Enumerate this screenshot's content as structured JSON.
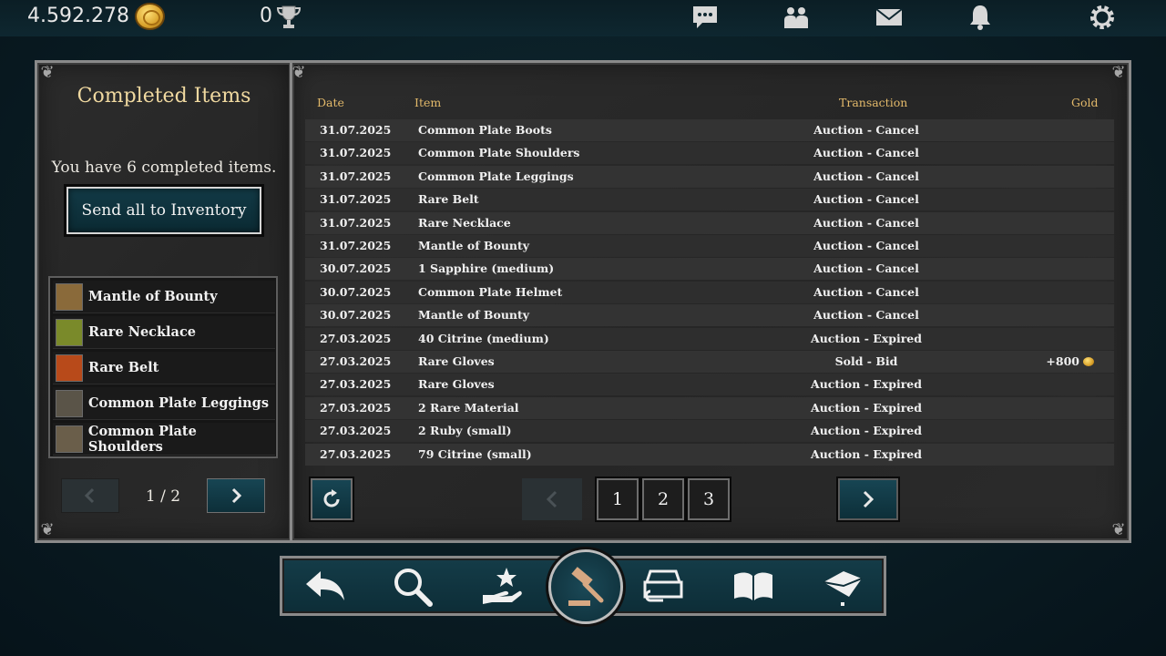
{
  "topbar": {
    "gold": "4.592.278",
    "trophies": "0",
    "icons": [
      "chat-icon",
      "friends-icon",
      "mail-icon",
      "bell-icon",
      "gear-icon"
    ]
  },
  "left": {
    "title": "Completed Items",
    "count_text": "You have 6 completed items.",
    "send_all_label": "Send all to Inventory",
    "items": [
      {
        "label": "Mantle of Bounty",
        "color": "#8a6a3a"
      },
      {
        "label": "Rare Necklace",
        "color": "#7a8a2a"
      },
      {
        "label": "Rare Belt",
        "color": "#b84a1a"
      },
      {
        "label": "Common Plate Leggings",
        "color": "#5a5448"
      },
      {
        "label": "Common Plate Shoulders",
        "color": "#6a5e4a"
      }
    ],
    "page_indicator": "1 / 2"
  },
  "table": {
    "headers": {
      "date": "Date",
      "item": "Item",
      "transaction": "Transaction",
      "gold": "Gold"
    },
    "rows": [
      {
        "date": "31.07.2025",
        "item": "Common Plate Boots",
        "transaction": "Auction - Cancel",
        "gold": ""
      },
      {
        "date": "31.07.2025",
        "item": "Common Plate Shoulders",
        "transaction": "Auction - Cancel",
        "gold": ""
      },
      {
        "date": "31.07.2025",
        "item": "Common Plate Leggings",
        "transaction": "Auction - Cancel",
        "gold": ""
      },
      {
        "date": "31.07.2025",
        "item": "Rare Belt",
        "transaction": "Auction - Cancel",
        "gold": ""
      },
      {
        "date": "31.07.2025",
        "item": "Rare Necklace",
        "transaction": "Auction - Cancel",
        "gold": ""
      },
      {
        "date": "31.07.2025",
        "item": "Mantle of Bounty",
        "transaction": "Auction - Cancel",
        "gold": ""
      },
      {
        "date": "30.07.2025",
        "item": "1 Sapphire (medium)",
        "transaction": "Auction - Cancel",
        "gold": ""
      },
      {
        "date": "30.07.2025",
        "item": "Common Plate Helmet",
        "transaction": "Auction - Cancel",
        "gold": ""
      },
      {
        "date": "30.07.2025",
        "item": "Mantle of Bounty",
        "transaction": "Auction - Cancel",
        "gold": ""
      },
      {
        "date": "27.03.2025",
        "item": "40 Citrine (medium)",
        "transaction": "Auction - Expired",
        "gold": ""
      },
      {
        "date": "27.03.2025",
        "item": "Rare Gloves",
        "transaction": "Sold - Bid",
        "gold": "+800"
      },
      {
        "date": "27.03.2025",
        "item": "Rare Gloves",
        "transaction": "Auction - Expired",
        "gold": ""
      },
      {
        "date": "27.03.2025",
        "item": "2 Rare Material",
        "transaction": "Auction - Expired",
        "gold": ""
      },
      {
        "date": "27.03.2025",
        "item": "2 Ruby (small)",
        "transaction": "Auction - Expired",
        "gold": ""
      },
      {
        "date": "27.03.2025",
        "item": "79 Citrine (small)",
        "transaction": "Auction - Expired",
        "gold": ""
      }
    ],
    "pages": [
      "1",
      "2",
      "3"
    ]
  },
  "bottom_nav": [
    "back-icon",
    "search-icon",
    "offer-icon",
    "auction-gavel-icon",
    "register-icon",
    "book-icon",
    "envelope-icon"
  ]
}
